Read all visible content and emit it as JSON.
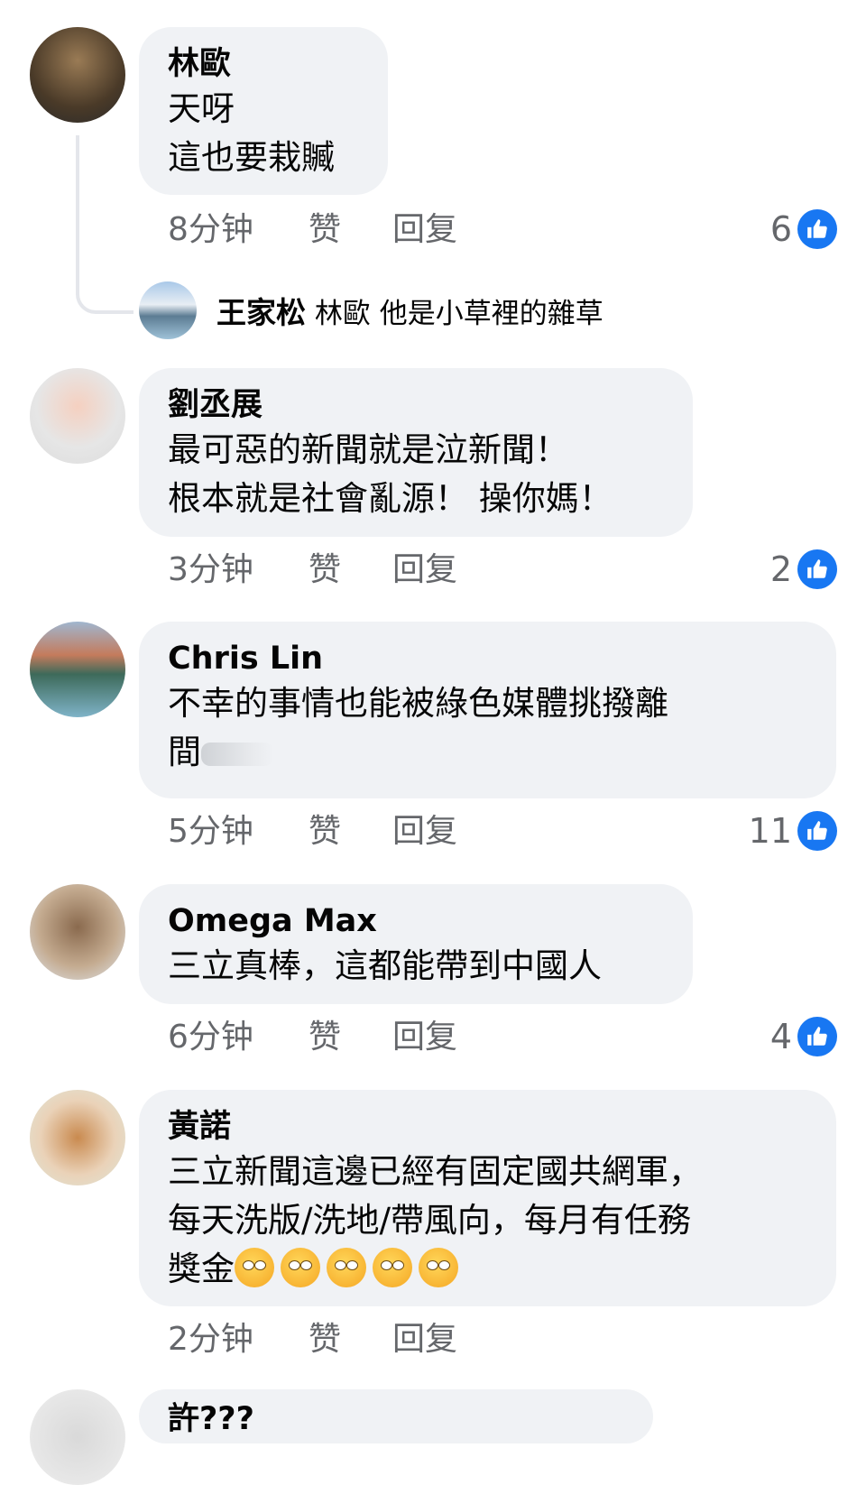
{
  "comments": [
    {
      "author": "林歐",
      "lines": [
        "天呀",
        "這也要栽贓"
      ],
      "time": "8分钟",
      "like": "赞",
      "reply": "回复",
      "likes": "6"
    },
    {
      "author": "劉丞展",
      "lines": [
        "最可惡的新聞就是泣新聞！",
        "根本就是社會亂源！ 操你媽！"
      ],
      "time": "3分钟",
      "like": "赞",
      "reply": "回复",
      "likes": "2"
    },
    {
      "author": "Chris Lin",
      "lines": [
        "不幸的事情也能被綠色媒體挑撥離",
        "間"
      ],
      "time": "5分钟",
      "like": "赞",
      "reply": "回复",
      "likes": "11"
    },
    {
      "author": "Omega Max",
      "lines": [
        "三立真棒，這都能帶到中國人"
      ],
      "time": "6分钟",
      "like": "赞",
      "reply": "回复",
      "likes": "4"
    },
    {
      "author": "黃諾",
      "lines": [
        "三立新聞這邊已經有固定國共網軍，",
        "每天洗版/洗地/帶風向，每月有任務",
        "獎金"
      ],
      "time": "2分钟",
      "like": "赞",
      "reply": "回复"
    },
    {
      "author": "許???"
    }
  ],
  "reply_preview": {
    "author": "王家松",
    "text": "林歐 他是小草裡的雜草"
  },
  "icons": {
    "like": "thumbs-up-icon",
    "reaction": "rolling-eyes-emoji"
  },
  "colors": {
    "bubble": "#f0f2f5",
    "accent": "#1877f2",
    "meta": "#65676b"
  }
}
